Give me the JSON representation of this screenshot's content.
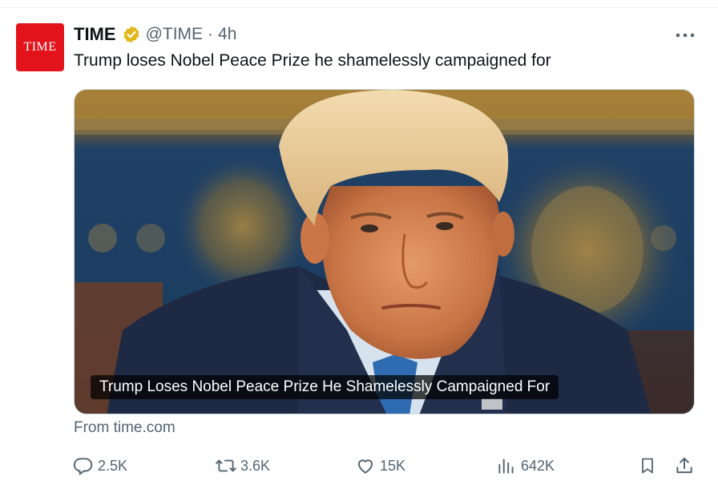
{
  "author": {
    "avatar_text": "TIME",
    "name": "TIME",
    "handle": "@TIME",
    "separator": "·",
    "time": "4h"
  },
  "tweet": {
    "text": "Trump loses Nobel Peace Prize he shamelessly campaigned for"
  },
  "card": {
    "caption": "Trump Loses Nobel Peace Prize He Shamelessly Campaigned For",
    "source": "From time.com"
  },
  "actions": {
    "reply_count": "2.5K",
    "retweet_count": "3.6K",
    "like_count": "15K",
    "view_count": "642K"
  },
  "colors": {
    "brand": "#e3131b",
    "verified_gold": "#e2b719",
    "muted_text": "#536471"
  },
  "icons": [
    "verified-badge-icon",
    "more-icon",
    "reply-icon",
    "retweet-icon",
    "like-icon",
    "views-icon",
    "bookmark-icon",
    "share-icon"
  ]
}
